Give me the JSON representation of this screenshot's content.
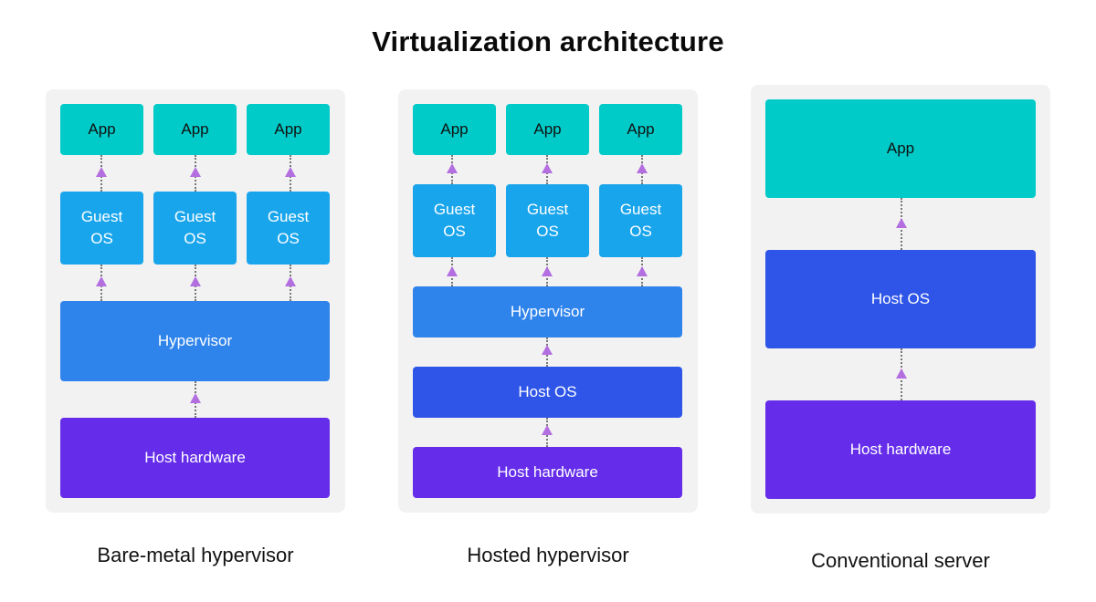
{
  "title": "Virtualization architecture",
  "colors": {
    "panel_bg": "#f2f2f2",
    "app": "#00cbc8",
    "guest_os": "#19a5ec",
    "hypervisor": "#2f84ec",
    "host_os": "#2f55e8",
    "host_hardware": "#652dea",
    "arrow": "#b36ee0",
    "connector": "#777777"
  },
  "diagrams": [
    {
      "caption": "Bare-metal hypervisor",
      "apps": [
        "App",
        "App",
        "App"
      ],
      "guest_os": [
        "Guest OS",
        "Guest OS",
        "Guest OS"
      ],
      "hypervisor": "Hypervisor",
      "host_hardware": "Host hardware"
    },
    {
      "caption": "Hosted hypervisor",
      "apps": [
        "App",
        "App",
        "App"
      ],
      "guest_os": [
        "Guest OS",
        "Guest OS",
        "Guest OS"
      ],
      "hypervisor": "Hypervisor",
      "host_os": "Host OS",
      "host_hardware": "Host hardware"
    },
    {
      "caption": "Conventional server",
      "app": "App",
      "host_os": "Host OS",
      "host_hardware": "Host hardware"
    }
  ]
}
